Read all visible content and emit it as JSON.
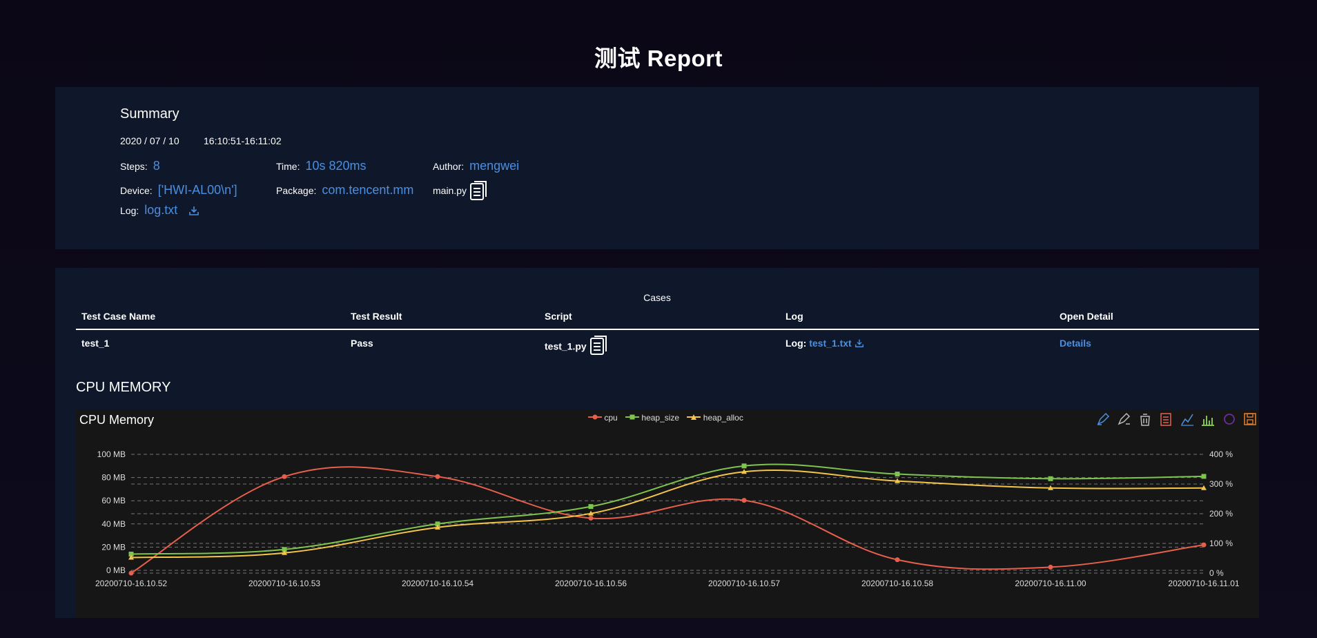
{
  "page_title": "测试 Report",
  "summary": {
    "title": "Summary",
    "date": "2020 / 07 / 10",
    "time_range": "16:10:51-16:11:02",
    "steps_label": "Steps:",
    "steps_value": "8",
    "time_label": "Time:",
    "time_value": "10s 820ms",
    "author_label": "Author:",
    "author_value": "mengwei",
    "device_label": "Device:",
    "device_value": "['HWI-AL00\\n']",
    "package_label": "Package:",
    "package_value": "com.tencent.mm",
    "script_name": "main.py",
    "log_label": "Log:",
    "log_value": "log.txt"
  },
  "cases": {
    "caption": "Cases",
    "headers": [
      "Test Case Name",
      "Test Result",
      "Script",
      "Log",
      "Open Detail"
    ],
    "rows": [
      {
        "name": "test_1",
        "result": "Pass",
        "script": "test_1.py",
        "log_label": "Log:",
        "log_file": "test_1.txt",
        "detail": "Details"
      }
    ]
  },
  "section_title": "CPU MEMORY",
  "colors": {
    "cpu": "#e8604c",
    "heap_size": "#7fc44f",
    "heap_alloc": "#f5c54a",
    "link": "#4a8fe0"
  },
  "icons": [
    "zoom-icon",
    "zoom-reset-icon",
    "restore-icon",
    "data-view-icon",
    "line-chart-icon",
    "bar-chart-icon",
    "stack-icon",
    "save-image-icon"
  ],
  "chart_data": {
    "type": "line",
    "title": "CPU Memory",
    "x": [
      "20200710-16.10.52",
      "20200710-16.10.53",
      "20200710-16.10.54",
      "20200710-16.10.56",
      "20200710-16.10.57",
      "20200710-16.10.58",
      "20200710-16.11.00",
      "20200710-16.11.01"
    ],
    "left_axis": {
      "ticks": [
        "0 MB",
        "20 MB",
        "40 MB",
        "60 MB",
        "80 MB",
        "100 MB"
      ],
      "ylim": [
        0,
        100
      ]
    },
    "right_axis": {
      "ticks": [
        "0 %",
        "100 %",
        "200 %",
        "300 %",
        "400 %"
      ],
      "ylim": [
        0,
        400
      ]
    },
    "series": [
      {
        "name": "cpu",
        "axis": "right",
        "marker": "circle",
        "values": [
          0,
          325,
          325,
          185,
          245,
          45,
          20,
          95
        ]
      },
      {
        "name": "heap_size",
        "axis": "left",
        "marker": "square",
        "values": [
          14,
          18,
          40,
          55,
          90,
          83,
          79,
          81
        ]
      },
      {
        "name": "heap_alloc",
        "axis": "left",
        "marker": "triangle",
        "values": [
          11,
          15,
          37,
          49,
          85,
          77,
          71,
          71
        ]
      }
    ],
    "grid": true,
    "legend_position": "top-center"
  }
}
